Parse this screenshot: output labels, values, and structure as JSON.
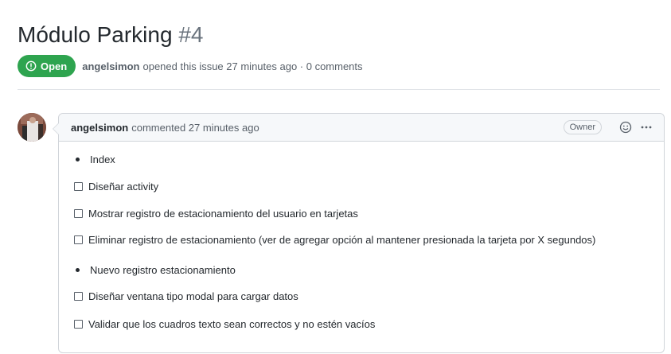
{
  "issue": {
    "title": "Módulo Parking",
    "number": "#4",
    "state": "Open",
    "author": "angelsimon",
    "opened_text": "opened this issue 27 minutes ago · 0 comments"
  },
  "comment": {
    "author": "angelsimon",
    "action": "commented 27 minutes ago",
    "owner_badge": "Owner",
    "items": [
      {
        "type": "bullet",
        "text": "Index"
      },
      {
        "type": "checkbox",
        "checked": false,
        "text": "Diseñar activity"
      },
      {
        "type": "checkbox",
        "checked": false,
        "text": "Mostrar registro de estacionamiento del usuario en tarjetas"
      },
      {
        "type": "checkbox",
        "checked": false,
        "text": "Eliminar registro de estacionamiento (ver de agregar opción al mantener presionada la tarjeta por X segundos)"
      },
      {
        "type": "bullet",
        "text": "Nuevo registro estacionamiento"
      },
      {
        "type": "checkbox",
        "checked": false,
        "text": "Diseñar ventana tipo modal para cargar datos"
      },
      {
        "type": "checkbox",
        "checked": false,
        "text": "Validar que los cuadros texto sean correctos y no estén vacíos"
      }
    ]
  },
  "icons": {
    "state": "issue-opened-icon",
    "reaction": "smiley-icon",
    "more": "kebab-horizontal-icon"
  },
  "colors": {
    "open_green": "#2ea44f",
    "text": "#24292e",
    "muted": "#586069",
    "border": "#d1d5da",
    "header_bg": "#f6f8fa"
  }
}
